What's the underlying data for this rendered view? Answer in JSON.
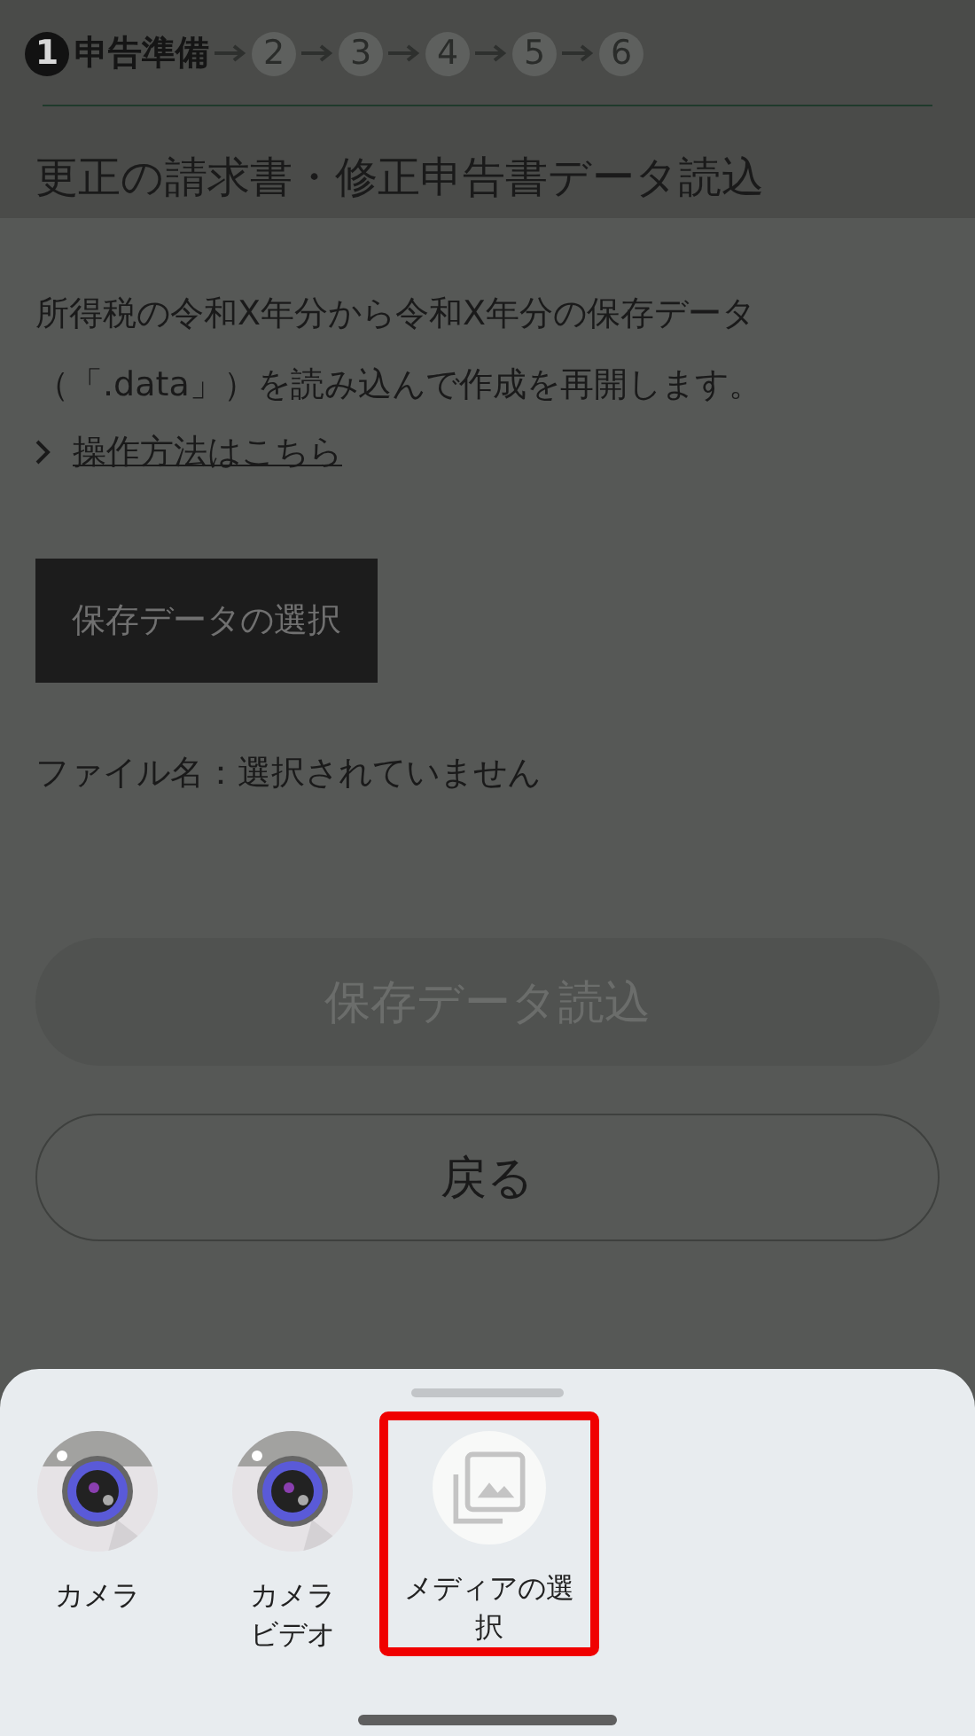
{
  "steps": [
    {
      "number": "1",
      "label": "申告準備",
      "selected": true
    },
    {
      "number": "2",
      "selected": false
    },
    {
      "number": "3",
      "selected": false
    },
    {
      "number": "4",
      "selected": false
    },
    {
      "number": "5",
      "selected": false
    },
    {
      "number": "6",
      "selected": false
    }
  ],
  "title": "更正の請求書・修正申告書データ読込",
  "description": "所得税の令和X年分から令和X年分の保存データ（「.data」）を読み込んで作成を再開します。",
  "help_link": "操作方法はこちら",
  "select_button": "保存データの選択",
  "file_name": "ファイル名：選択されていません",
  "load_button": {
    "label": "保存データ読込",
    "disabled": true
  },
  "back_button": "戻る",
  "sheet": {
    "items": [
      {
        "kind": "camera",
        "label": "カメラ",
        "highlighted": false
      },
      {
        "kind": "camera",
        "label": "カメラビデオ",
        "highlighted": false
      },
      {
        "kind": "media",
        "label": "メディアの選択",
        "highlighted": true
      }
    ]
  }
}
